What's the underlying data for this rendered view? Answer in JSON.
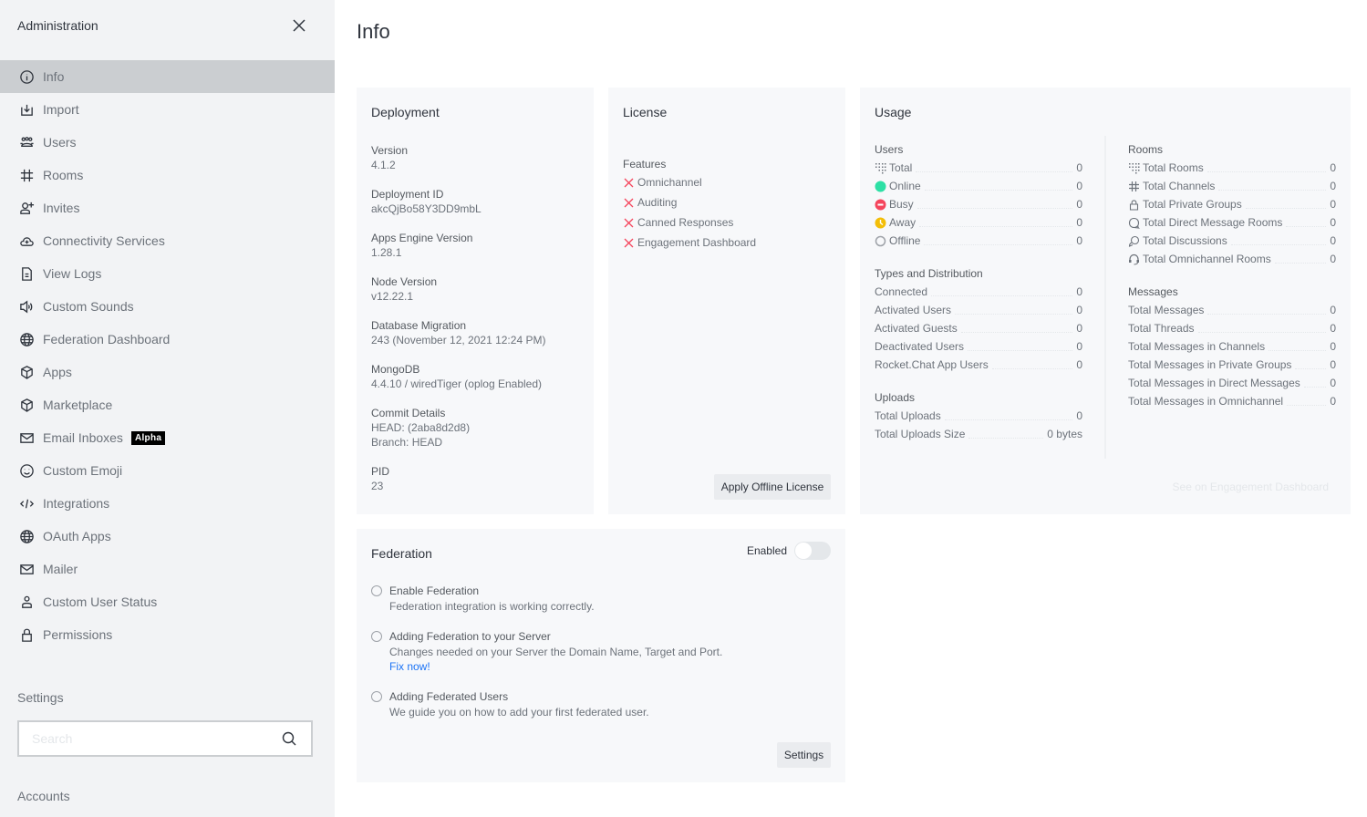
{
  "sidebar": {
    "title": "Administration",
    "items": [
      {
        "label": "Info",
        "icon": "info-circle-icon",
        "active": true
      },
      {
        "label": "Import",
        "icon": "import-icon"
      },
      {
        "label": "Users",
        "icon": "users-icon"
      },
      {
        "label": "Rooms",
        "icon": "hashtag-icon"
      },
      {
        "label": "Invites",
        "icon": "user-plus-icon"
      },
      {
        "label": "Connectivity Services",
        "icon": "cloud-plus-icon"
      },
      {
        "label": "View Logs",
        "icon": "file-icon"
      },
      {
        "label": "Custom Sounds",
        "icon": "speaker-icon"
      },
      {
        "label": "Federation Dashboard",
        "icon": "globe-icon"
      },
      {
        "label": "Apps",
        "icon": "cube-icon"
      },
      {
        "label": "Marketplace",
        "icon": "cube-icon"
      },
      {
        "label": "Email Inboxes",
        "icon": "mail-icon",
        "badge": "Alpha"
      },
      {
        "label": "Custom Emoji",
        "icon": "emoji-icon"
      },
      {
        "label": "Integrations",
        "icon": "code-icon"
      },
      {
        "label": "OAuth Apps",
        "icon": "globe-icon"
      },
      {
        "label": "Mailer",
        "icon": "mail-icon"
      },
      {
        "label": "Custom User Status",
        "icon": "user-icon"
      },
      {
        "label": "Permissions",
        "icon": "lock-icon"
      }
    ],
    "settings_label": "Settings",
    "search_placeholder": "Search",
    "accounts_label": "Accounts"
  },
  "page": {
    "title": "Info"
  },
  "deployment": {
    "title": "Deployment",
    "fields": [
      {
        "label": "Version",
        "value": "4.1.2"
      },
      {
        "label": "Deployment ID",
        "value": "akcQjBo58Y3DD9mbL"
      },
      {
        "label": "Apps Engine Version",
        "value": "1.28.1"
      },
      {
        "label": "Node Version",
        "value": "v12.22.1"
      },
      {
        "label": "Database Migration",
        "value": "243 (November 12, 2021 12:24 PM)"
      },
      {
        "label": "MongoDB",
        "value": "4.4.10 / wiredTiger (oplog Enabled)"
      },
      {
        "label": "Commit Details",
        "value": "HEAD: (2aba8d2d8)",
        "value2": "Branch: HEAD"
      },
      {
        "label": "PID",
        "value": "23"
      }
    ]
  },
  "license": {
    "title": "License",
    "features_label": "Features",
    "features": [
      "Omnichannel",
      "Auditing",
      "Canned Responses",
      "Engagement Dashboard"
    ],
    "apply_button": "Apply Offline License"
  },
  "usage": {
    "title": "Usage",
    "users": {
      "label": "Users",
      "rows": [
        {
          "label": "Total",
          "value": "0",
          "icon": "total-grid-icon"
        },
        {
          "label": "Online",
          "value": "0",
          "icon": "status-online-icon"
        },
        {
          "label": "Busy",
          "value": "0",
          "icon": "status-busy-icon"
        },
        {
          "label": "Away",
          "value": "0",
          "icon": "status-away-icon"
        },
        {
          "label": "Offline",
          "value": "0",
          "icon": "status-offline-icon"
        }
      ]
    },
    "types": {
      "label": "Types and Distribution",
      "rows": [
        {
          "label": "Connected",
          "value": "0"
        },
        {
          "label": "Activated Users",
          "value": "0"
        },
        {
          "label": "Activated Guests",
          "value": "0"
        },
        {
          "label": "Deactivated Users",
          "value": "0"
        },
        {
          "label": "Rocket.Chat App Users",
          "value": "0"
        }
      ]
    },
    "uploads": {
      "label": "Uploads",
      "rows": [
        {
          "label": "Total Uploads",
          "value": "0"
        },
        {
          "label": "Total Uploads Size",
          "value": "0 bytes"
        }
      ]
    },
    "rooms": {
      "label": "Rooms",
      "rows": [
        {
          "label": "Total Rooms",
          "value": "0",
          "icon": "total-grid-icon"
        },
        {
          "label": "Total Channels",
          "value": "0",
          "icon": "hashtag-icon"
        },
        {
          "label": "Total Private Groups",
          "value": "0",
          "icon": "lock-icon"
        },
        {
          "label": "Total Direct Message Rooms",
          "value": "0",
          "icon": "chat-bubble-icon"
        },
        {
          "label": "Total Discussions",
          "value": "0",
          "icon": "discussion-icon"
        },
        {
          "label": "Total Omnichannel Rooms",
          "value": "0",
          "icon": "headset-icon"
        }
      ]
    },
    "messages": {
      "label": "Messages",
      "rows": [
        {
          "label": "Total Messages",
          "value": "0"
        },
        {
          "label": "Total Threads",
          "value": "0"
        },
        {
          "label": "Total Messages in Channels",
          "value": "0"
        },
        {
          "label": "Total Messages in Private Groups",
          "value": "0"
        },
        {
          "label": "Total Messages in Direct Messages",
          "value": "0"
        },
        {
          "label": "Total Messages in Omnichannel",
          "value": "0"
        }
      ]
    },
    "see_link": "See on Engagement Dashboard"
  },
  "federation": {
    "title": "Federation",
    "toggle_label": "Enabled",
    "toggle_on": false,
    "items": [
      {
        "title": "Enable Federation",
        "desc": "Federation integration is working correctly."
      },
      {
        "title": "Adding Federation to your Server",
        "desc": "Changes needed on your Server the Domain Name, Target and Port.",
        "link": "Fix now!"
      },
      {
        "title": "Adding Federated Users",
        "desc": "We guide you on how to add your first federated user."
      }
    ],
    "settings_button": "Settings"
  },
  "colors": {
    "online": "#2de0a5",
    "busy": "#f5455c",
    "away": "#ffd21f",
    "offline": "#cbced1",
    "link": "#1d74f5",
    "error_x": "#f5455c"
  }
}
